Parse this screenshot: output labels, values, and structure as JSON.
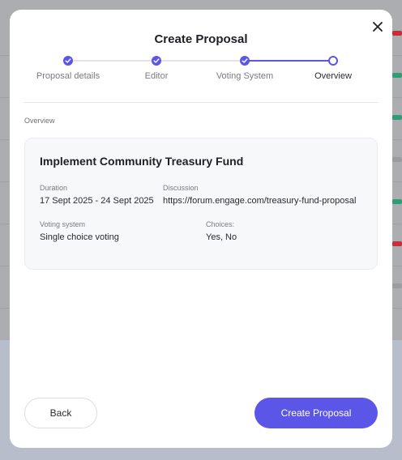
{
  "modal": {
    "title": "Create Proposal",
    "close_icon": "close-icon"
  },
  "stepper": {
    "steps": [
      {
        "label": "Proposal details",
        "state": "done"
      },
      {
        "label": "Editor",
        "state": "done"
      },
      {
        "label": "Voting System",
        "state": "done"
      },
      {
        "label": "Overview",
        "state": "current"
      }
    ]
  },
  "overview": {
    "section_label": "Overview",
    "proposal_title": "Implement Community Treasury Fund",
    "duration_label": "Duration",
    "duration_value": "17 Sept 2025 - 24 Sept 2025",
    "discussion_label": "Discussion",
    "discussion_value": "https://forum.engage.com/treasury-fund-proposal",
    "voting_system_label": "Voting system",
    "voting_system_value": "Single choice voting",
    "choices_label": "Choices:",
    "choices_value": "Yes, No"
  },
  "actions": {
    "back_label": "Back",
    "create_label": "Create Proposal"
  },
  "colors": {
    "accent": "#5b56e8",
    "background_marks": [
      "#c62f3a",
      "#2f9e74",
      "#2f9e74",
      "#9c9ca0",
      "#2f9e74",
      "#c62f3a",
      "#9c9ca0"
    ]
  }
}
